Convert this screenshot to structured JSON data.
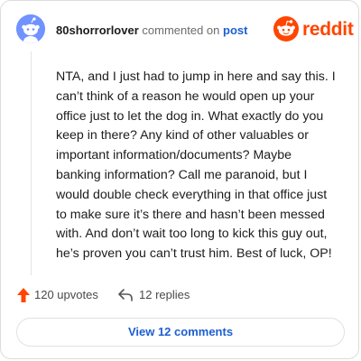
{
  "comment": {
    "username": "80shorrorlover",
    "commented_text": "commented on",
    "post_link": "post",
    "body": "NTA, and I just had to jump in here and say this. I can’t think of a reason he would open up your office just to let the dog in. What exactly do you keep in there? Any kind of other valuables or important information/documents? Maybe banking information? Call me paranoid, but I would double check everything in that office just to make sure it’s there and hasn’t been messed with. And don’t wait too long to kick this guy out, he’s proven you can’t trust him. Best of luck, OP!"
  },
  "brand": {
    "name": "reddit",
    "color": "#ff4500"
  },
  "actions": {
    "upvotes": "120 upvotes",
    "replies": "12 replies"
  },
  "view_comments_label": "View 12 comments",
  "icons": {
    "avatar": "snoo-avatar",
    "logo": "reddit-snoo-icon",
    "upvote": "upvote-arrow-icon",
    "reply": "reply-arrow-icon"
  },
  "colors": {
    "link": "#1d5fd1",
    "upvote": "#ff4500",
    "avatar_bg": "#7193ff"
  }
}
